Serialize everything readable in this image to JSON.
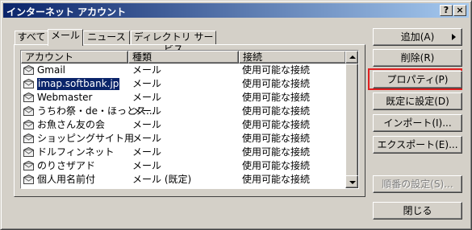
{
  "window": {
    "title": "インターネット アカウント",
    "help_glyph": "?",
    "close_glyph": "×"
  },
  "tabs": [
    {
      "label": "すべて"
    },
    {
      "label": "メール"
    },
    {
      "label": "ニュース"
    },
    {
      "label": "ディレクトリ サービス"
    }
  ],
  "active_tab": "メール",
  "list": {
    "columns": [
      "アカウント",
      "種類",
      "接続"
    ],
    "selected_account": "imap.softbank.jp",
    "rows": [
      {
        "account": "Gmail",
        "type": "メール",
        "connection": "使用可能な接続"
      },
      {
        "account": "imap.softbank.jp",
        "type": "メール",
        "connection": "使用可能な接続"
      },
      {
        "account": "Webmaster",
        "type": "メール",
        "connection": "使用可能な接続"
      },
      {
        "account": "うちわ祭・de・ほっとス...",
        "type": "メール",
        "connection": "使用可能な接続"
      },
      {
        "account": "お魚さん友の会",
        "type": "メール",
        "connection": "使用可能な接続"
      },
      {
        "account": "ショッピングサイト用",
        "type": "メール",
        "connection": "使用可能な接続"
      },
      {
        "account": "ドルフィンネット",
        "type": "メール",
        "connection": "使用可能な接続"
      },
      {
        "account": "のりさザアド",
        "type": "メール",
        "connection": "使用可能な接続"
      },
      {
        "account": "個人用名前付",
        "type": "メール (既定)",
        "connection": "使用可能な接続"
      }
    ]
  },
  "buttons": {
    "add": "追加(A)",
    "remove": "削除(R)",
    "properties": "プロパティ(P)",
    "set_default": "既定に設定(D)",
    "import": "インポート(I)...",
    "export": "エクスポート(E)...",
    "order": "順番の設定(S)...",
    "close": "閉じる"
  },
  "colors": {
    "titlebar_start": "#0a246a",
    "titlebar_end": "#a6caf0",
    "selection": "#0a246a",
    "highlight_box": "#e02020",
    "face": "#d4d0c8"
  }
}
